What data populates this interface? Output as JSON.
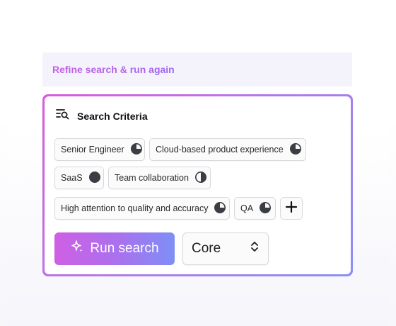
{
  "refine": {
    "label": "Refine search & run again"
  },
  "criteria": {
    "title": "Search Criteria",
    "title_icon": "search-list-icon",
    "chips": [
      {
        "label": "Senior Engineer",
        "icon": "pie-three-quarter-icon"
      },
      {
        "label": "Cloud-based product experience",
        "icon": "pie-three-quarter-icon"
      },
      {
        "label": "SaaS",
        "icon": "pie-full-icon"
      },
      {
        "label": "Team collaboration",
        "icon": "pie-half-icon"
      },
      {
        "label": "High attention to quality and accuracy",
        "icon": "pie-three-quarter-icon"
      },
      {
        "label": "QA",
        "icon": "pie-three-quarter-icon"
      }
    ],
    "add_icon": "plus-icon"
  },
  "actions": {
    "run_label": "Run search",
    "run_icon": "sparkle-icon",
    "mode_value": "Core",
    "mode_icon": "chevron-updown-icon"
  },
  "colors": {
    "accent_start": "#cf5fe4",
    "accent_end": "#7e8ff6",
    "chip_icon": "#3a3d42"
  }
}
